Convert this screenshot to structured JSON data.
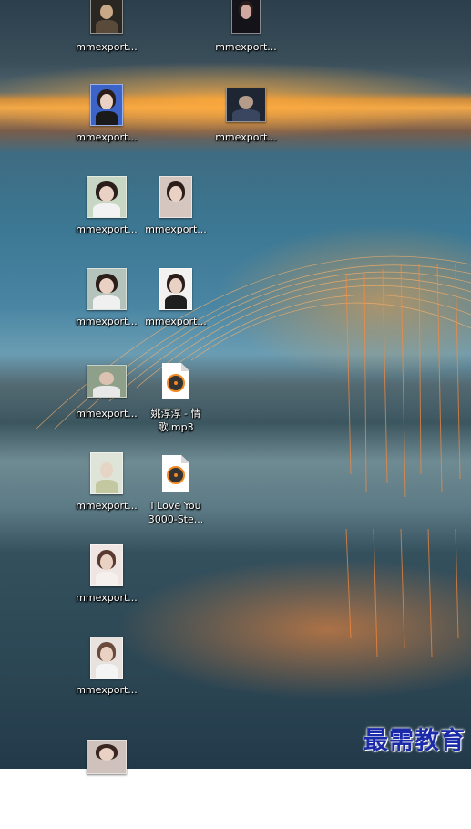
{
  "desktop": {
    "icons": [
      {
        "label": "mmexport..."
      },
      {
        "label": "mmexport..."
      },
      {
        "label": "mmexport..."
      },
      {
        "label": "mmexport..."
      },
      {
        "label": "mmexport..."
      },
      {
        "label": "mmexport..."
      },
      {
        "label": "mmexport..."
      },
      {
        "label": "mmexport..."
      },
      {
        "label": "mmexport..."
      },
      {
        "label": "姚淳淳 - 情\n歌.mp3"
      },
      {
        "label": "mmexport..."
      },
      {
        "label": "I Love You\n3000-Ste..."
      },
      {
        "label": "mmexport..."
      },
      {
        "label": "mmexport..."
      }
    ]
  },
  "watermark": {
    "text": "最需教育"
  }
}
